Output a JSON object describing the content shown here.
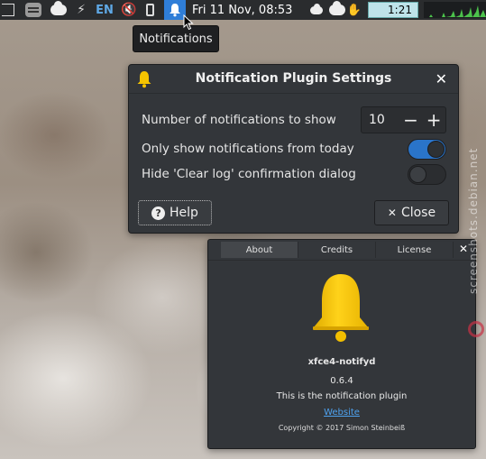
{
  "panel": {
    "language": "EN",
    "clock": "Fri 11 Nov, 08:53",
    "timer": "1:21"
  },
  "tooltip": {
    "text": "Notifications"
  },
  "settings": {
    "title": "Notification Plugin Settings",
    "rows": [
      {
        "label": "Number of notifications to show",
        "value": "10"
      },
      {
        "label": "Only show notifications from today",
        "enabled": true
      },
      {
        "label": "Hide 'Clear log' confirmation dialog",
        "enabled": false
      }
    ],
    "help_label": "Help",
    "close_label": "Close",
    "decrement_glyph": "−",
    "increment_glyph": "+"
  },
  "about": {
    "tabs": [
      "About",
      "Credits",
      "License"
    ],
    "active_tab": "About",
    "app_name": "xfce4-notifyd",
    "version": "0.6.4",
    "description": "This is the notification plugin",
    "website_label": "Website",
    "copyright": "Copyright © 2017 Simon Steinbeiß"
  },
  "watermark": "screenshots.debian.net",
  "colors": {
    "accent": "#2a74c9",
    "bell_yellow": "#f5c400",
    "link": "#4ea2ef",
    "dialog_bg": "#33363a"
  }
}
